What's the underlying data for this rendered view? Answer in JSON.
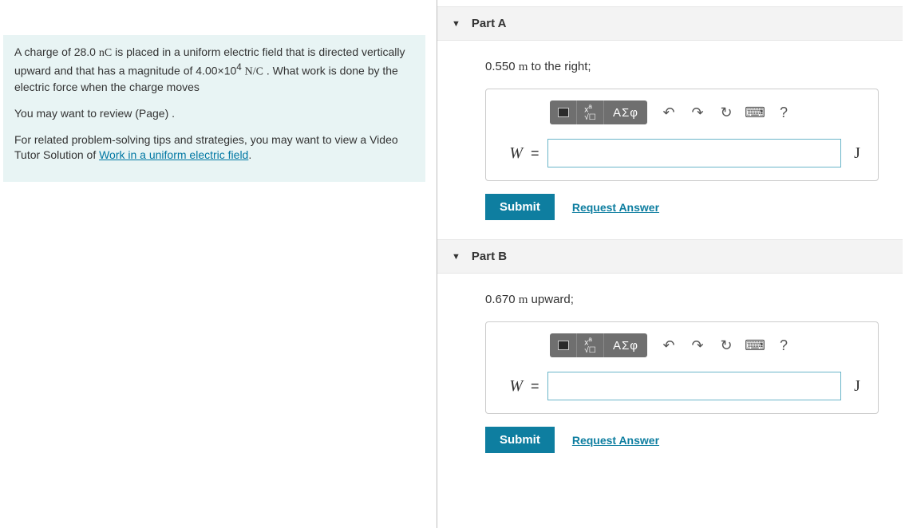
{
  "problem": {
    "intro_html": "A charge of 28.0 <span class='serif'>nC</span> is placed in a uniform electric field that is directed vertically upward and that has a magnitude of 4.00×10<sup>4</sup> <span class='serif'>N/C</span> . What work is done by the electric force when the charge moves",
    "review_text": "You may want to review (Page) .",
    "tips_prefix": "For related problem-solving tips and strategies, you may want to view a Video Tutor Solution of ",
    "tips_link_text": "Work in a uniform electric field",
    "tips_suffix": "."
  },
  "toolbar": {
    "greek_label": "ΑΣφ",
    "help_label": "?"
  },
  "parts": [
    {
      "title": "Part A",
      "prompt_html": "0.550 <span class='serif'>m</span> to the right;",
      "var": "W",
      "unit": "J",
      "submit_label": "Submit",
      "request_label": "Request Answer"
    },
    {
      "title": "Part B",
      "prompt_html": "0.670 <span class='serif'>m</span> upward;",
      "var": "W",
      "unit": "J",
      "submit_label": "Submit",
      "request_label": "Request Answer"
    }
  ]
}
